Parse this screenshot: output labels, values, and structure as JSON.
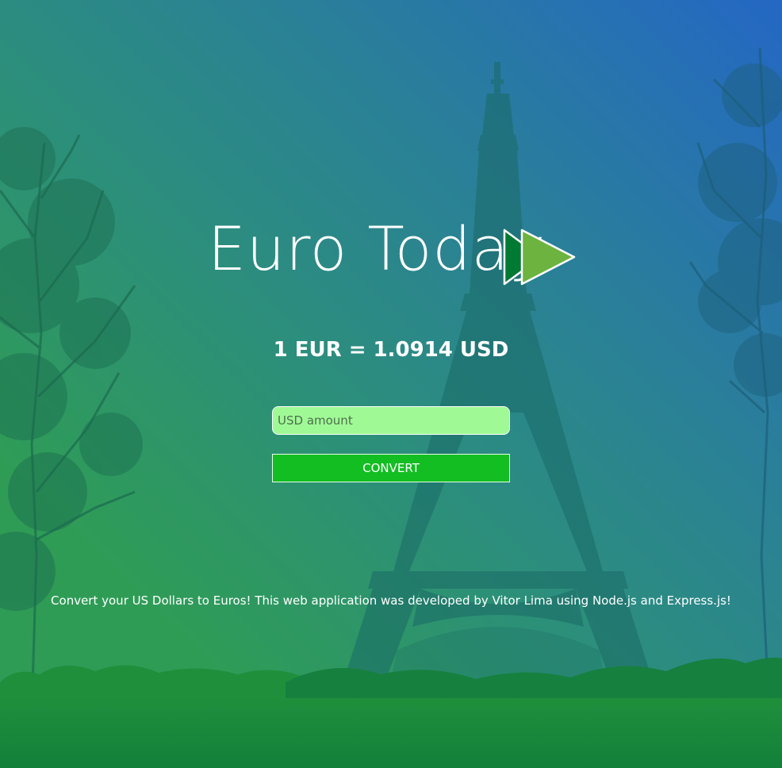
{
  "logo": {
    "title": "Euro Today",
    "icon": "double-play-arrow-icon",
    "arrow_dark_color": "#007a33",
    "arrow_light_color": "#6db33f"
  },
  "rate": {
    "text": "1 EUR = 1.0914 USD"
  },
  "form": {
    "input_placeholder": "USD amount",
    "input_value": "",
    "input_bg_color": "#9ffa95",
    "button_label": "CONVERT",
    "button_color": "#13be22"
  },
  "footer": {
    "text": "Convert your US Dollars to Euros! This web application was developed by Vitor Lima using Node.js and Express.js!"
  },
  "background": {
    "image": "eiffel-tower-silhouette-with-trees",
    "gradient_top_color": "#2467c4",
    "gradient_bottom_color": "#2f9c56"
  }
}
